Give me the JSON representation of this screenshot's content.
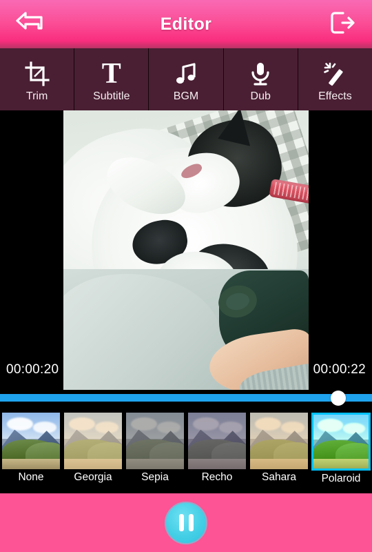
{
  "header": {
    "title": "Editor",
    "back_icon": "back-arrow-icon",
    "exit_icon": "exit-icon"
  },
  "toolbar": {
    "items": [
      {
        "label": "Trim",
        "icon": "crop-icon"
      },
      {
        "label": "Subtitle",
        "icon": "text-t-icon"
      },
      {
        "label": "BGM",
        "icon": "music-note-icon"
      },
      {
        "label": "Dub",
        "icon": "microphone-icon"
      },
      {
        "label": "Effects",
        "icon": "magic-wand-icon"
      }
    ]
  },
  "player": {
    "current_time": "00:00:20",
    "total_time": "00:00:22",
    "progress_percent": 91,
    "state": "playing",
    "pause_icon": "pause-icon"
  },
  "filters": {
    "selected": "Polaroid",
    "items": [
      {
        "label": "None",
        "tint": "none"
      },
      {
        "label": "Georgia",
        "tint": "rgba(238,206,156,0.55)"
      },
      {
        "label": "Sepia",
        "tint": "rgba(120,96,62,0.50)"
      },
      {
        "label": "Recho",
        "tint": "rgba(92,62,124,0.48)"
      },
      {
        "label": "Sahara",
        "tint": "rgba(232,190,128,0.52)"
      },
      {
        "label": "Polaroid",
        "tint": "rgba(120,220,140,0.22)"
      }
    ]
  },
  "colors": {
    "header_pink": "#FB4C95",
    "toolbar_maroon": "#4A1F33",
    "seekbar_blue": "#1FA3EF",
    "bottom_pink": "#FC5494",
    "play_cyan": "#44CFE6",
    "selection_blue": "#27A7E7"
  }
}
